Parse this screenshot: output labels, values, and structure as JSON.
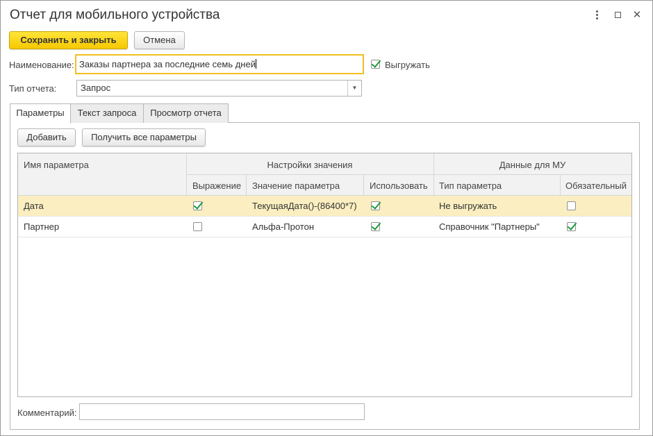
{
  "window": {
    "title": "Отчет для мобильного устройства"
  },
  "toolbar": {
    "save_close_label": "Сохранить и закрыть",
    "cancel_label": "Отмена"
  },
  "form": {
    "name_label": "Наименование:",
    "name_value": "Заказы партнера за последние семь дней",
    "export_label": "Выгружать",
    "export_checked": true,
    "type_label": "Тип отчета:",
    "type_value": "Запрос",
    "comment_label": "Комментарий:",
    "comment_value": ""
  },
  "tabs": [
    {
      "label": "Параметры",
      "active": true
    },
    {
      "label": "Текст запроса",
      "active": false
    },
    {
      "label": "Просмотр отчета",
      "active": false
    }
  ],
  "params_toolbar": {
    "add_label": "Добавить",
    "get_all_label": "Получить все параметры"
  },
  "grid": {
    "col_name": "Имя параметра",
    "group_value_settings": "Настройки значения",
    "group_mu_data": "Данные для МУ",
    "col_expression": "Выражение",
    "col_param_value": "Значение параметра",
    "col_use": "Использовать",
    "col_param_type": "Тип параметра",
    "col_required": "Обязательный",
    "rows": [
      {
        "name": "Дата",
        "expression": true,
        "value": "ТекущаяДата()-(86400*7)",
        "use": true,
        "type": "Не выгружать",
        "required": false,
        "selected": true
      },
      {
        "name": "Партнер",
        "expression": false,
        "value": "Альфа-Протон",
        "use": true,
        "type": "Справочник \"Партнеры\"",
        "required": true,
        "selected": false
      }
    ]
  },
  "colors": {
    "accent": "#f6c800",
    "selected_row": "#fbeec0",
    "check": "#1e9a3e"
  }
}
